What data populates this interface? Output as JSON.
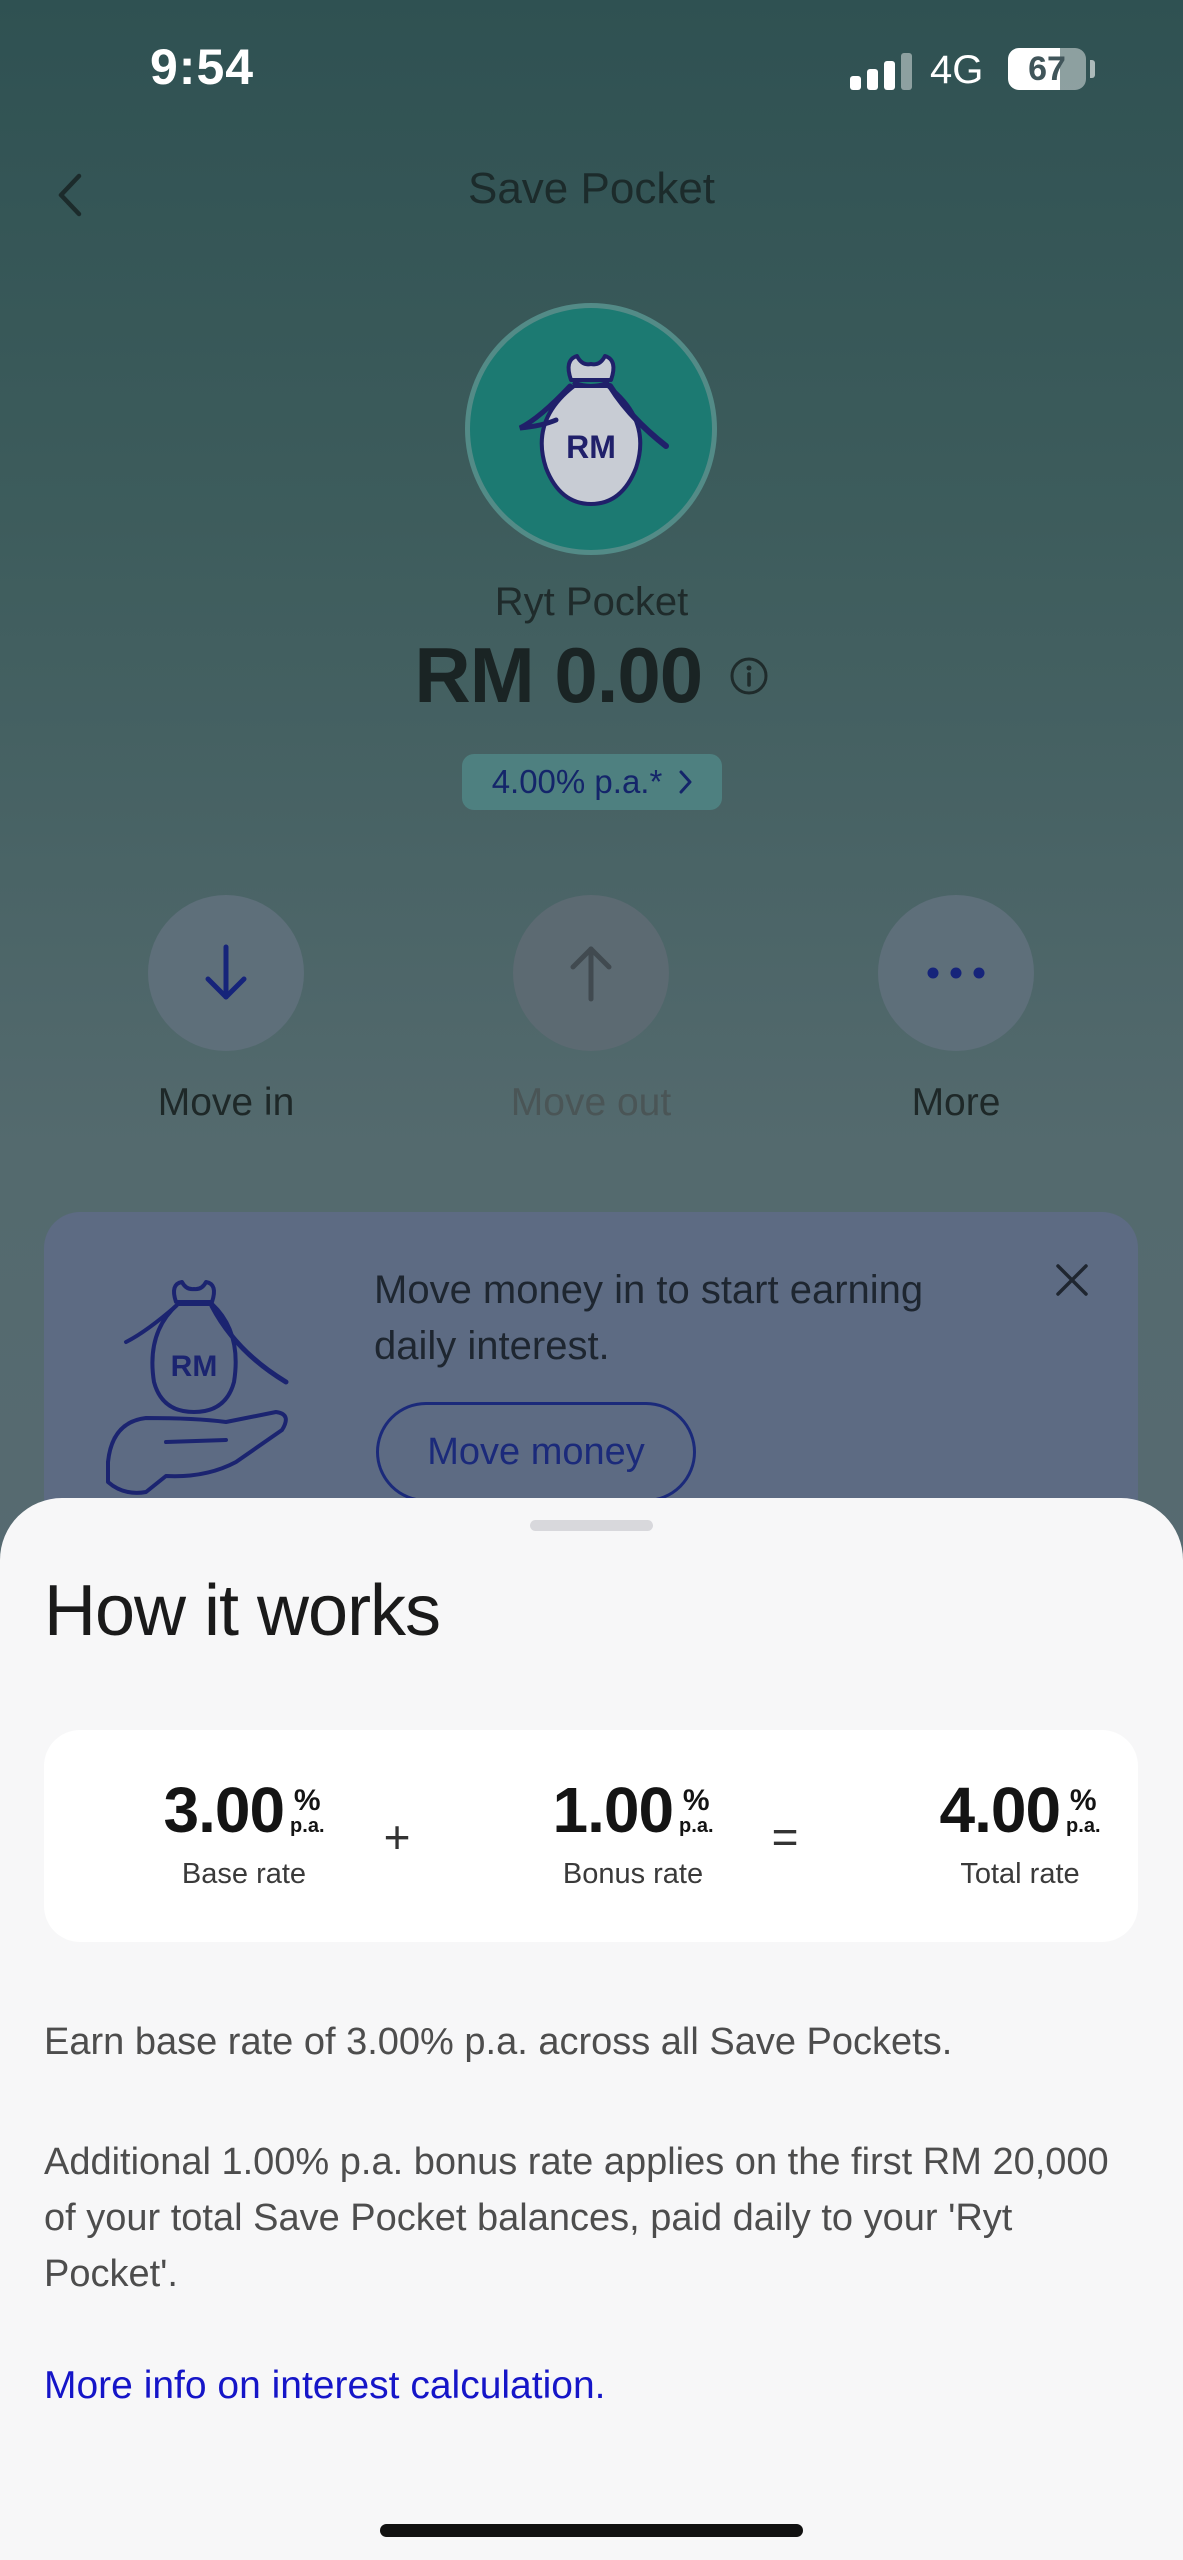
{
  "status_bar": {
    "time": "9:54",
    "network": "4G",
    "battery_level": "67",
    "battery_fraction": 0.67
  },
  "header": {
    "title": "Save Pocket",
    "back_icon": "chevron-left-icon"
  },
  "pocket": {
    "avatar_icon": "money-bag-icon",
    "avatar_text": "RM",
    "name": "Ryt Pocket",
    "balance": "RM 0.00",
    "info_icon": "info-icon",
    "rate_chip": "4.00% p.a.*"
  },
  "actions": [
    {
      "label": "Move in",
      "icon": "arrow-down-icon",
      "enabled": true
    },
    {
      "label": "Move out",
      "icon": "arrow-up-icon",
      "enabled": false
    },
    {
      "label": "More",
      "icon": "more-dots-icon",
      "enabled": true
    }
  ],
  "banner": {
    "text": "Move money in to start earning daily interest.",
    "illustration_text": "RM",
    "button_label": "Move money",
    "close_icon": "close-icon"
  },
  "sheet": {
    "title": "How it works",
    "rates": {
      "base": {
        "value": "3.00",
        "percent": "%",
        "pa": "p.a.",
        "label": "Base rate"
      },
      "bonus": {
        "value": "1.00",
        "percent": "%",
        "pa": "p.a.",
        "label": "Bonus rate"
      },
      "total": {
        "value": "4.00",
        "percent": "%",
        "pa": "p.a.",
        "label": "Total rate"
      },
      "plus": "+",
      "equals": "="
    },
    "para1": "Earn base rate of 3.00% p.a. across all Save Pockets.",
    "para2": "Additional 1.00% p.a. bonus rate applies on the first RM 20,000 of your total Save Pocket balances, paid daily to your 'Ryt Pocket'.",
    "link": "More info on interest calculation."
  },
  "colors": {
    "accent": "#1515c8",
    "avatar_bg": "#1c7a72",
    "sheet_bg": "#f7f7f8"
  }
}
